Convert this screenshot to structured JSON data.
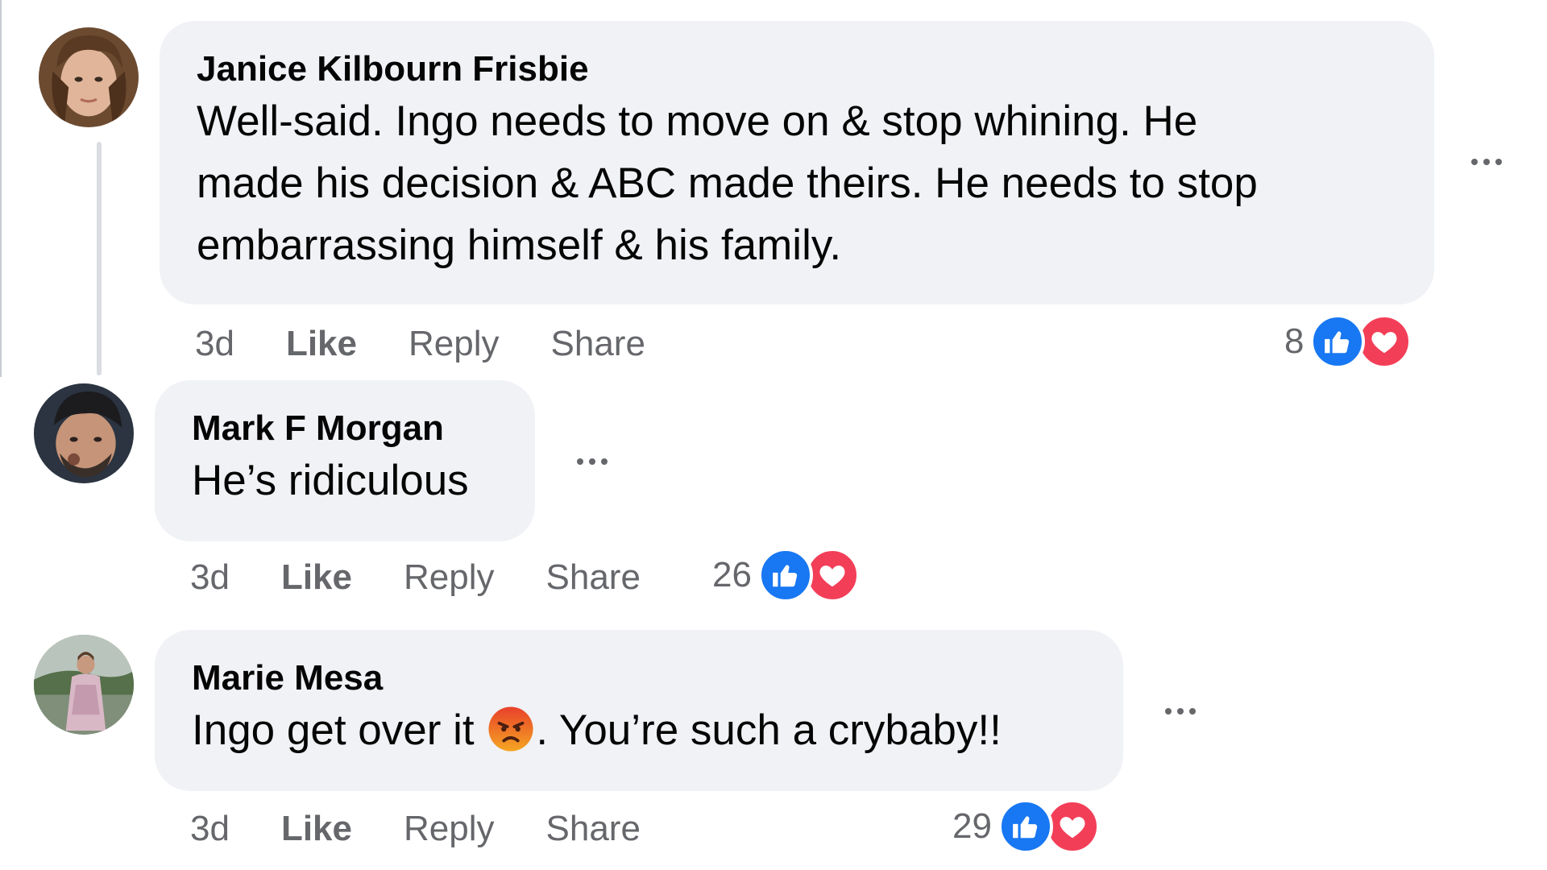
{
  "comments": [
    {
      "author": "Janice Kilbourn Frisbie",
      "lines": [
        "Well-said. Ingo needs to move on & stop whining. He",
        "made his decision & ABC made theirs. He needs to stop",
        "embarrassing himself & his family."
      ],
      "time": "3d",
      "like_label": "Like",
      "reply_label": "Reply",
      "share_label": "Share",
      "reaction_count": "8",
      "reactions": [
        "like-icon",
        "love-icon"
      ]
    },
    {
      "author": "Mark F Morgan",
      "lines": [
        "He’s ridiculous"
      ],
      "time": "3d",
      "like_label": "Like",
      "reply_label": "Reply",
      "share_label": "Share",
      "reaction_count": "26",
      "reactions": [
        "like-icon",
        "love-icon"
      ]
    },
    {
      "author": "Marie Mesa",
      "text_before_emoji": "Ingo get over it ",
      "emoji": "angry-face-emoji",
      "text_after_emoji": ". You’re such a crybaby!!",
      "time": "3d",
      "like_label": "Like",
      "reply_label": "Reply",
      "share_label": "Share",
      "reaction_count": "29",
      "reactions": [
        "like-icon",
        "love-icon"
      ]
    }
  ],
  "colors": {
    "bubble": "#f0f2f5",
    "text": "#050505",
    "secondary": "#65676b",
    "like_blue": "#1877f2",
    "love_red": "#f33e58"
  }
}
